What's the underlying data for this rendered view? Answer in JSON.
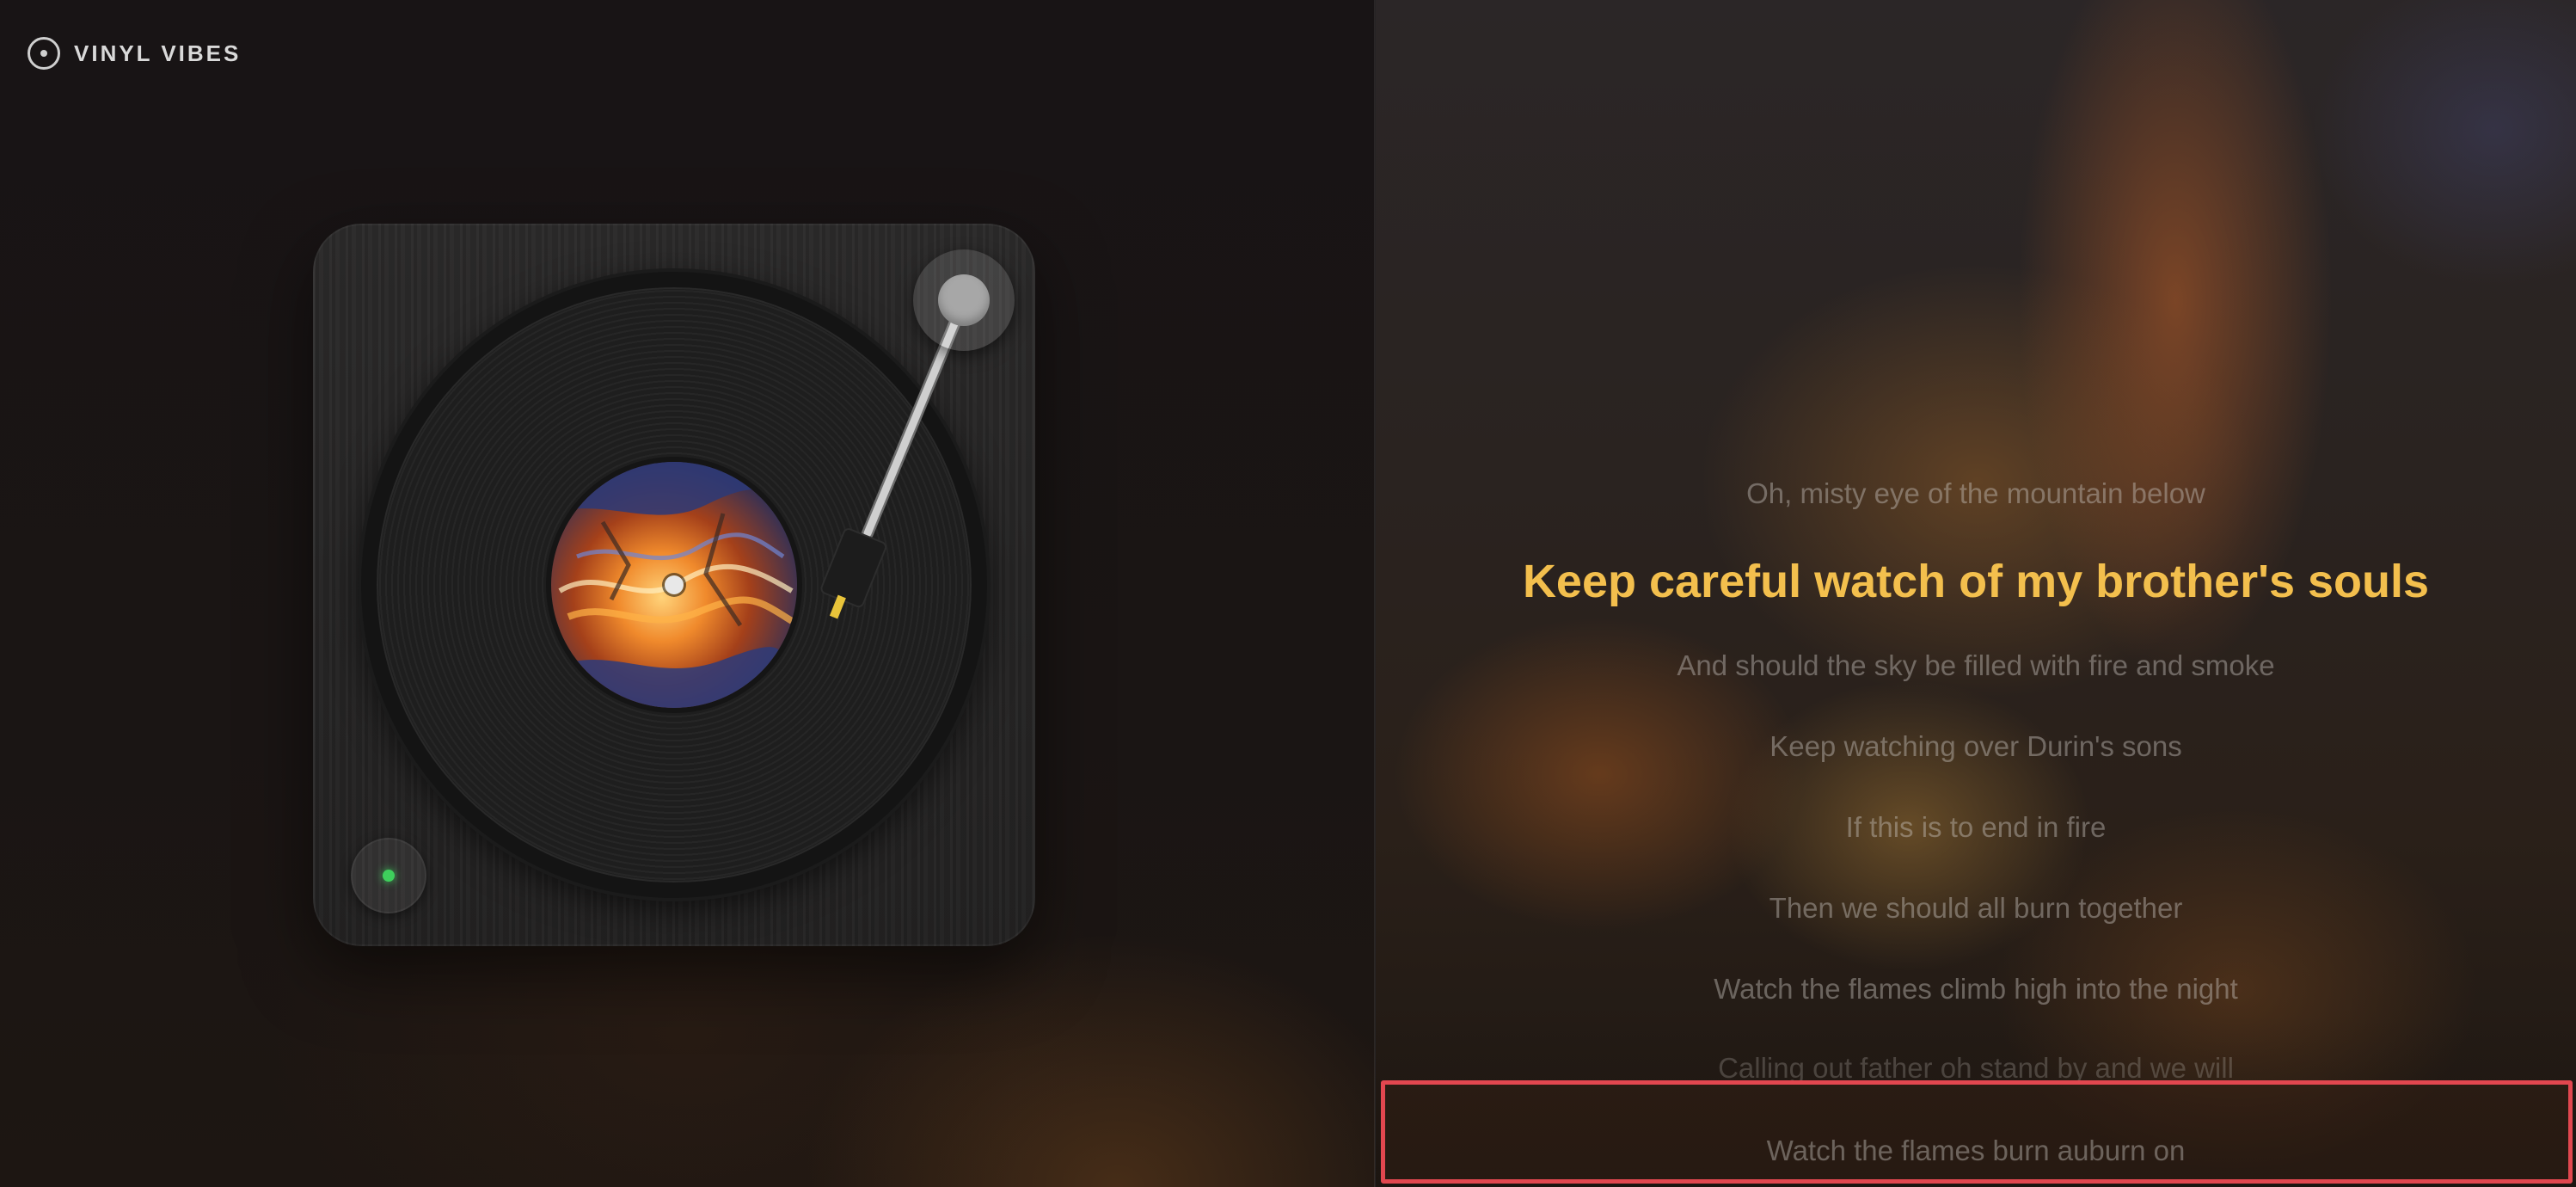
{
  "app": {
    "brand_name": "VINYL VIBES",
    "brand_icon": "vinyl-disc-icon"
  },
  "player": {
    "record_art": "fiery-abstract-artwork",
    "power_status_color": "#3ecf5c",
    "accent_color": "#f3bf4d",
    "highlight_color": "#e2474f"
  },
  "lyrics": {
    "lines": [
      "Oh, misty eye of the mountain below",
      "Keep careful watch of my brother's souls",
      "And should the sky be filled with fire and smoke",
      "Keep watching over Durin's sons",
      "If this is to end in fire",
      "Then we should all burn together",
      "Watch the flames climb high into the night",
      "Calling out father oh stand by and we will",
      "Watch the flames burn auburn on"
    ],
    "active_index": 1
  }
}
